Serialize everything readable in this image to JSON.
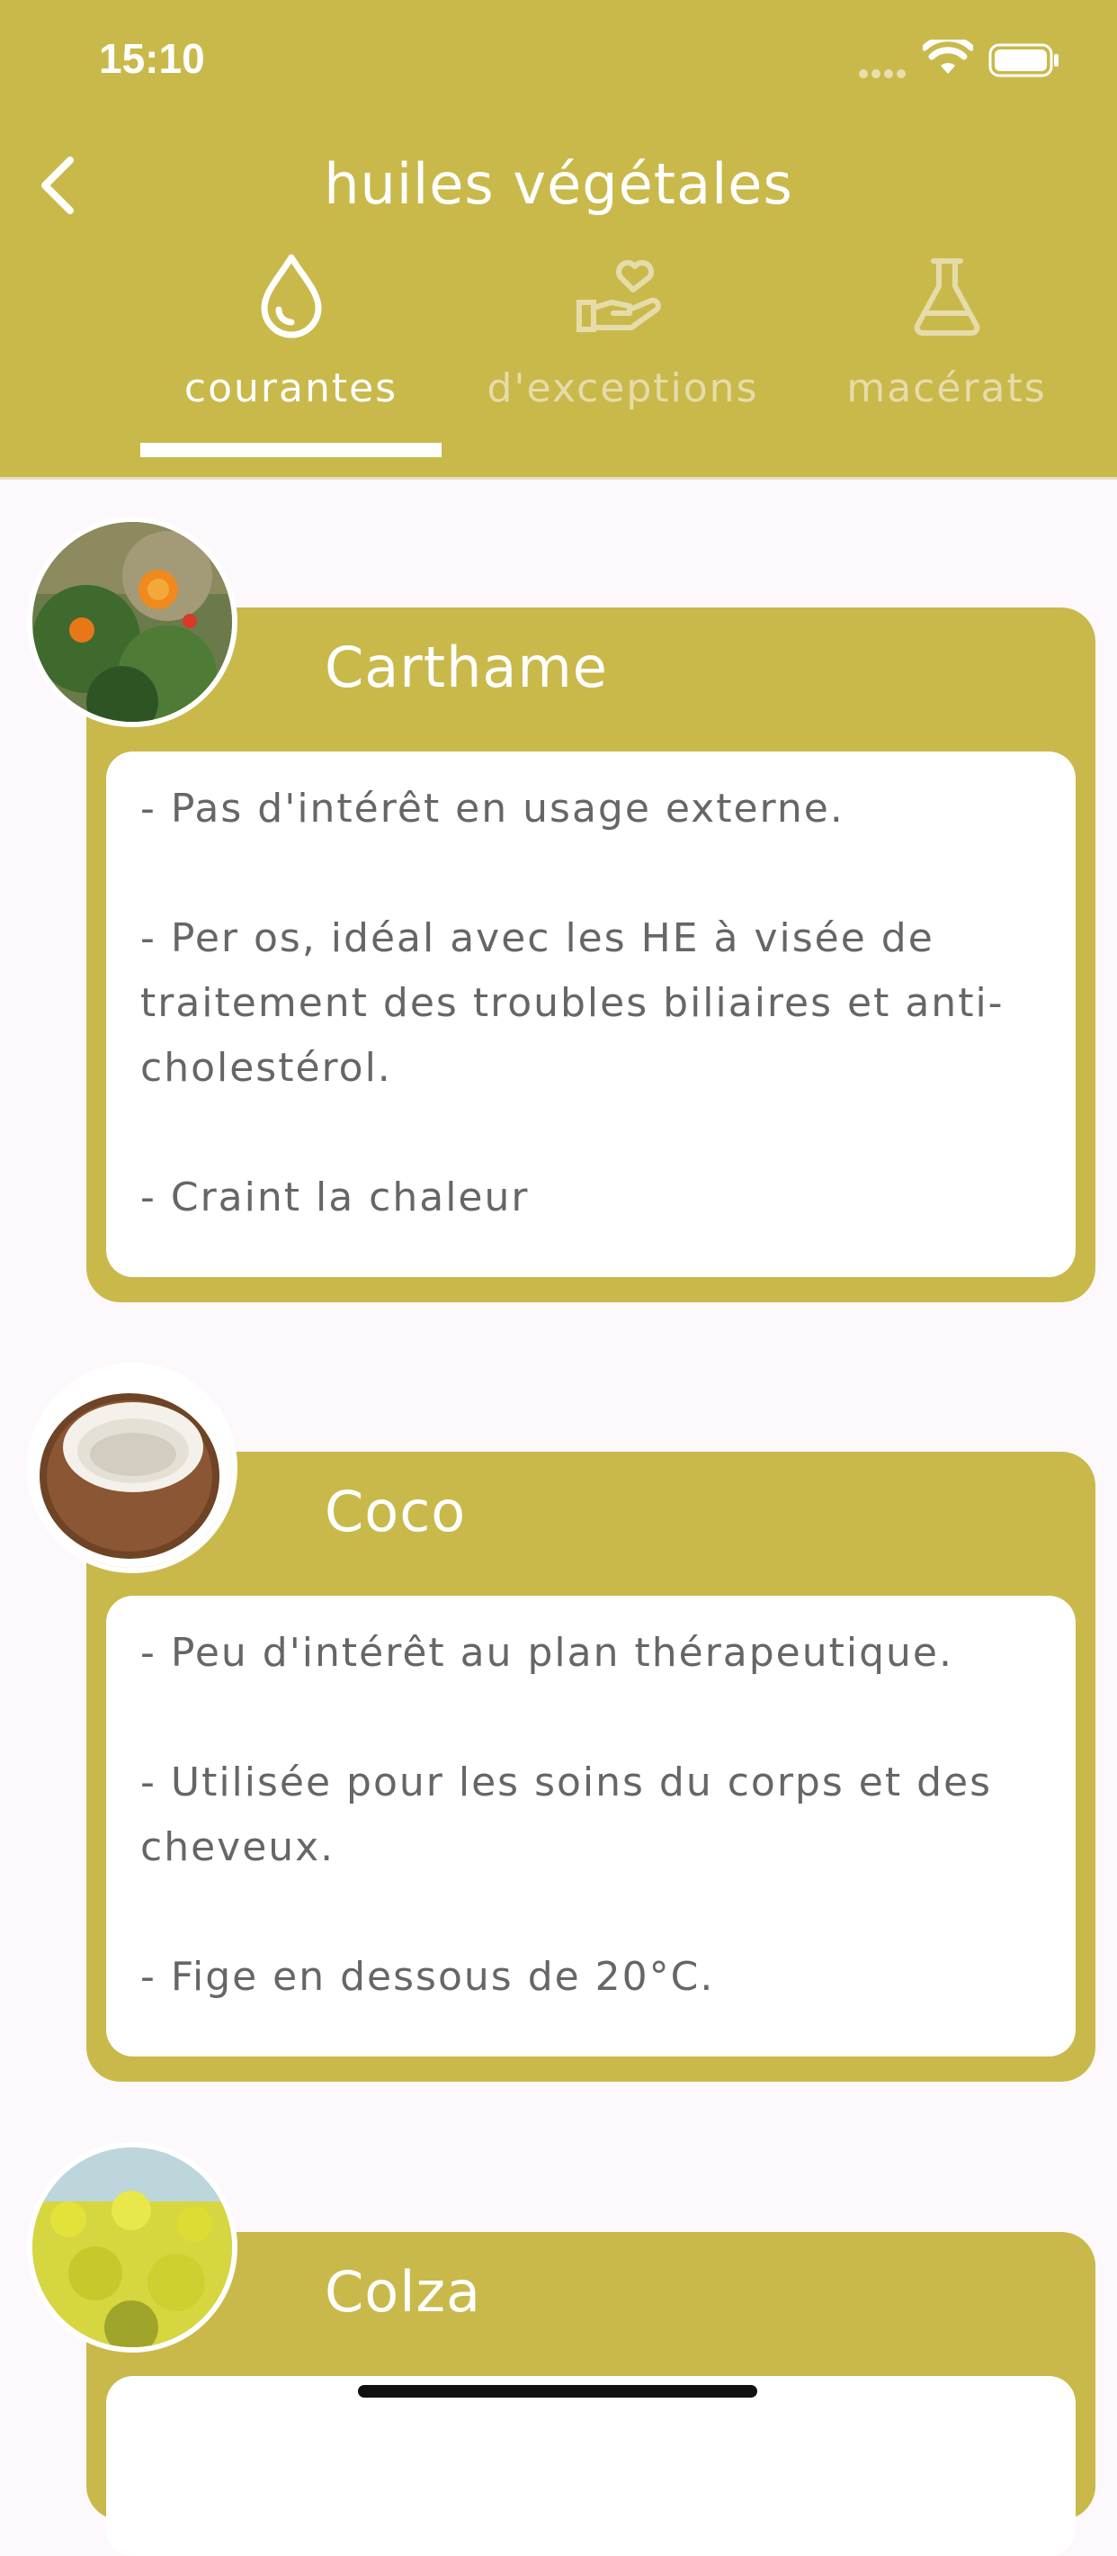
{
  "status_bar": {
    "time": "15:10"
  },
  "header": {
    "title": "huiles végétales"
  },
  "tabs": [
    {
      "label": "courantes",
      "icon": "drop-icon",
      "active": true
    },
    {
      "label": "d'exceptions",
      "icon": "hand-heart-icon",
      "active": false
    },
    {
      "label": "macérats",
      "icon": "flask-icon",
      "active": false
    }
  ],
  "colors": {
    "primary": "#c9b94b",
    "background": "#fdf8fc",
    "text": "#666666",
    "tab_inactive": "#e6dcaa"
  },
  "oils": [
    {
      "name": "Carthame",
      "image": "safflower-photo",
      "lines": [
        "- Pas d'intérêt en usage externe.",
        "- Per os, idéal avec les HE à visée de traitement des troubles biliaires et anti-cholestérol.",
        "- Craint la chaleur"
      ]
    },
    {
      "name": "Coco",
      "image": "coconut-photo",
      "lines": [
        "- Peu d'intérêt au plan thérapeutique.",
        "- Utilisée pour les soins du corps et des cheveux.",
        "- Fige en dessous de 20°C."
      ]
    },
    {
      "name": "Colza",
      "image": "rapeseed-photo",
      "lines": []
    }
  ]
}
